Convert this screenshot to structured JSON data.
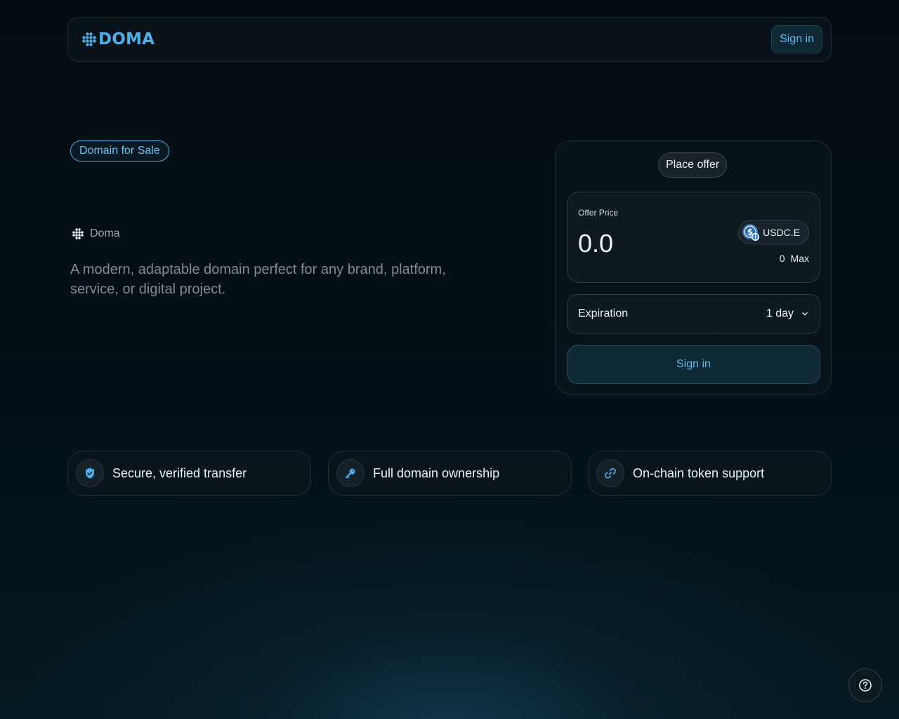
{
  "header": {
    "logo_text": "DOMA",
    "sign_in_label": "Sign in"
  },
  "hero": {
    "badge": "Domain for Sale",
    "brand_name": "Doma",
    "description": "A modern, adaptable domain perfect for any brand, platform, service, or digital project."
  },
  "offer": {
    "tab_label": "Place offer",
    "price_label": "Offer Price",
    "price_value": "0.0",
    "token": "USDC.E",
    "balance": "0",
    "max_label": "Max",
    "expiration_label": "Expiration",
    "expiration_value": "1 day",
    "submit_label": "Sign in"
  },
  "features": [
    {
      "label": "Secure, verified transfer",
      "icon": "shield-check-icon"
    },
    {
      "label": "Full domain ownership",
      "icon": "key-icon"
    },
    {
      "label": "On-chain token support",
      "icon": "link-icon"
    }
  ],
  "colors": {
    "accent": "#4cb1ea",
    "background": "#041017"
  }
}
